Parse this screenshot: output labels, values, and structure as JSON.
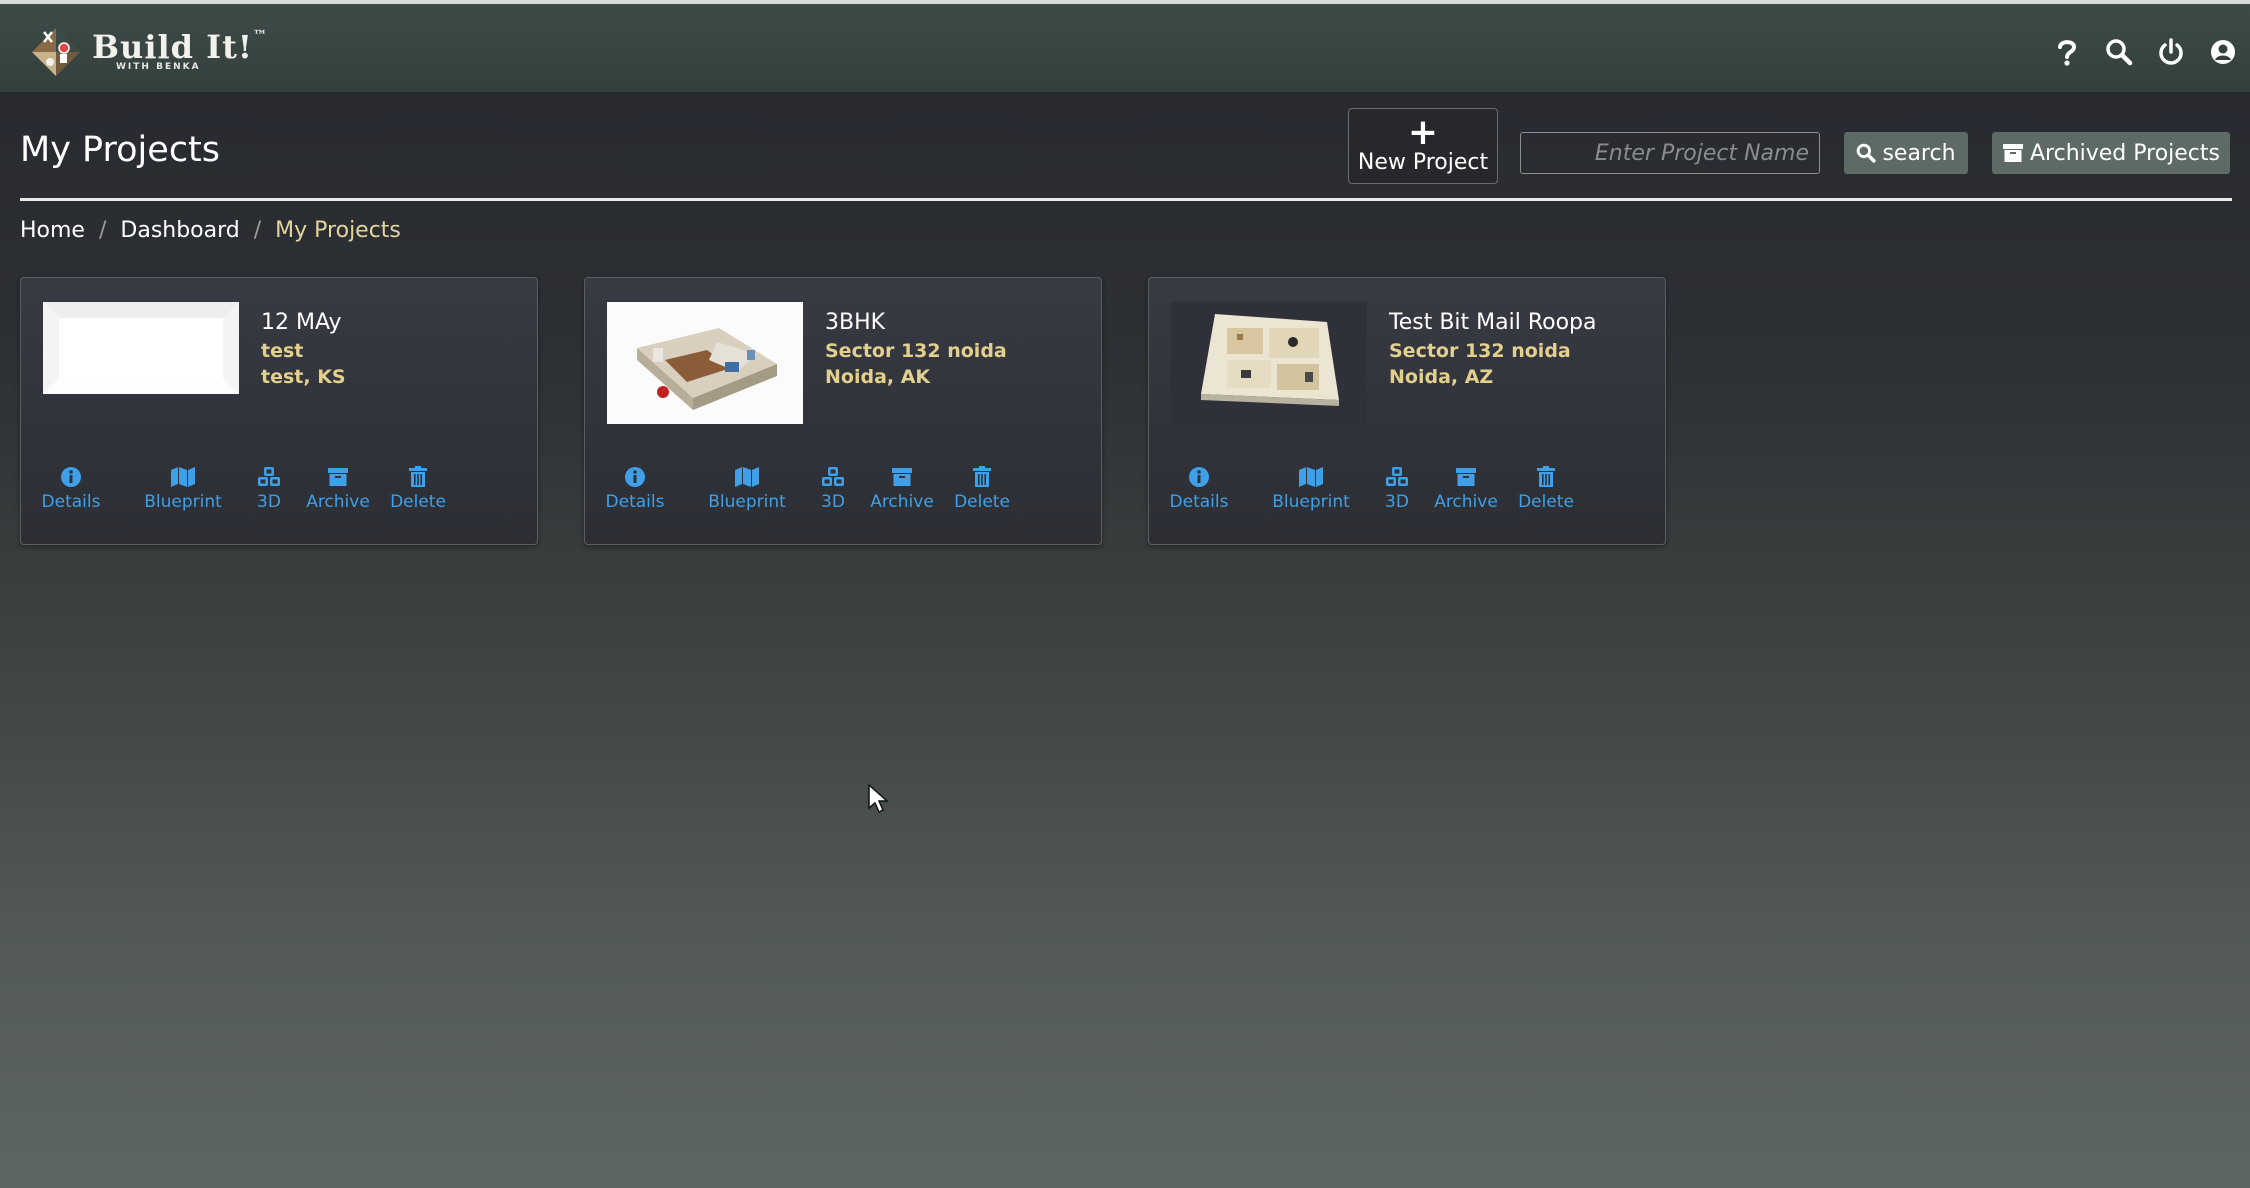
{
  "app": {
    "logo_text": "Build It!",
    "logo_trademark": "™",
    "logo_subtitle": "WITH BENKA"
  },
  "nav_icons": [
    "help-icon",
    "search-icon",
    "power-icon",
    "user-icon"
  ],
  "header": {
    "title": "My Projects",
    "new_project_label": "New Project",
    "search_placeholder": "Enter Project Name",
    "search_value": "",
    "search_button_label": "search",
    "archived_button_label": "Archived Projects"
  },
  "breadcrumb": {
    "items": [
      "Home",
      "Dashboard",
      "My Projects"
    ],
    "separator": "/"
  },
  "projects": [
    {
      "name": "12 MAy",
      "address": "test",
      "city_state": "test, KS",
      "thumbnail": "blank-plan"
    },
    {
      "name": "3BHK",
      "address": "Sector 132 noida",
      "city_state": "Noida, AK",
      "thumbnail": "3d-floorplan"
    },
    {
      "name": "Test Bit Mail Roopa",
      "address": "Sector 132 noida",
      "city_state": "Noida, AZ",
      "thumbnail": "3d-floorplan-topdown"
    }
  ],
  "card_actions": [
    {
      "label": "Details",
      "icon": "info-icon"
    },
    {
      "label": "Blueprint",
      "icon": "map-icon"
    },
    {
      "label": "3D",
      "icon": "cubes-icon"
    },
    {
      "label": "Archive",
      "icon": "archive-icon"
    },
    {
      "label": "Delete",
      "icon": "trash-icon"
    }
  ],
  "colors": {
    "accent": "#3fa0e8",
    "address": "#e3d08c",
    "breadcrumb_active": "#e3d59c",
    "navbar": "#3a4644"
  }
}
